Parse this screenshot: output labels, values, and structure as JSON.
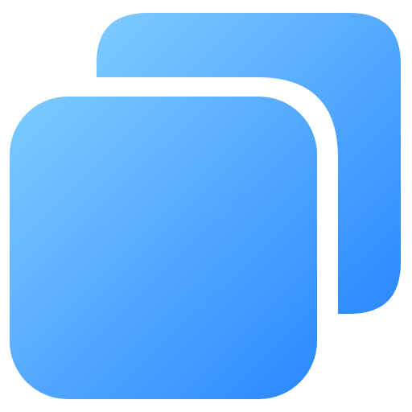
{
  "icon": {
    "name": "copy-icon",
    "gradient": {
      "light": "#7ECBFF",
      "dark": "#2A88FF"
    },
    "background": "#FFFFFF"
  }
}
